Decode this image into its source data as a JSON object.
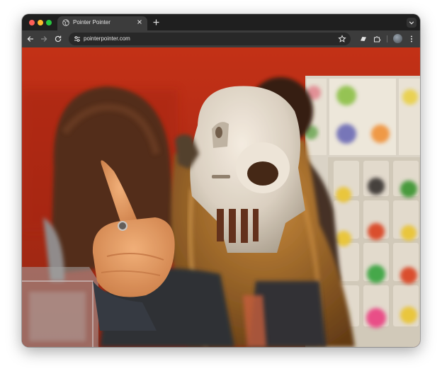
{
  "browser": {
    "tab": {
      "title": "Pointer Pointer"
    },
    "toolbar": {
      "url": "pointerpointer.com"
    }
  },
  "page": {
    "photo": {
      "description_icon": "photo-of-person-pointing"
    }
  },
  "colors": {
    "titlebar": "#1f1f1f",
    "toolbar": "#3c3c3c",
    "omnibox": "#282828",
    "wall": "#b02412"
  }
}
